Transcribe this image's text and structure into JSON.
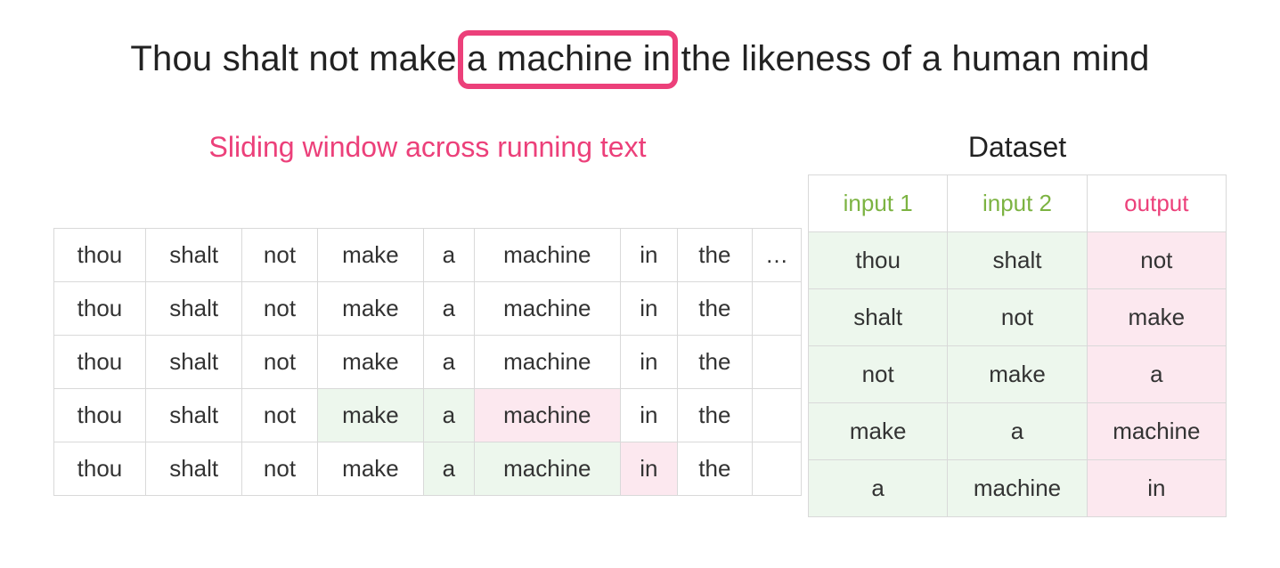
{
  "sentence": {
    "words": [
      "Thou",
      "shalt",
      "not",
      "make",
      "a",
      "machine",
      "in",
      "the",
      "likeness",
      "of",
      "a",
      "human",
      "mind"
    ],
    "highlight_start": 4,
    "highlight_end": 6
  },
  "captions": {
    "left": "Sliding window across running text",
    "right": "Dataset"
  },
  "left_table": {
    "tokens": [
      "thou",
      "shalt",
      "not",
      "make",
      "a",
      "machine",
      "in",
      "the"
    ],
    "ellipsis": "…",
    "rows": [
      {
        "highlight": {}
      },
      {
        "highlight": {}
      },
      {
        "highlight": {}
      },
      {
        "highlight": {
          "3": "green",
          "4": "green",
          "5": "pink"
        }
      },
      {
        "highlight": {
          "4": "green",
          "5": "green",
          "6": "pink"
        }
      }
    ]
  },
  "right_table": {
    "headers": [
      "input 1",
      "input 2",
      "output"
    ],
    "rows": [
      [
        "thou",
        "shalt",
        "not"
      ],
      [
        "shalt",
        "not",
        "make"
      ],
      [
        "not",
        "make",
        "a"
      ],
      [
        "make",
        "a",
        "machine"
      ],
      [
        "a",
        "machine",
        "in"
      ]
    ]
  }
}
